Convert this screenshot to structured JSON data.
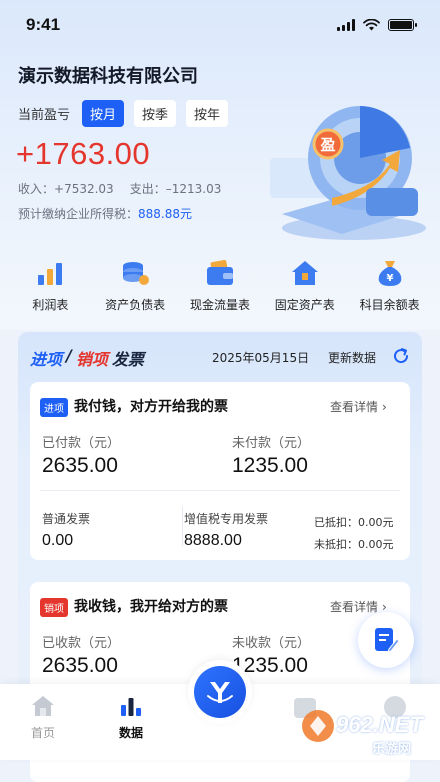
{
  "status_bar": {
    "time": "9:41"
  },
  "header": {
    "company": "演示数据科技有限公司",
    "period_label": "当前盈亏",
    "period_options": [
      "按月",
      "按季",
      "按年"
    ],
    "active_period": "按月",
    "profit": "+1763.00",
    "income_label": "收入：",
    "income_value": "+7532.03",
    "expense_label": "支出：",
    "expense_value": "–1213.03",
    "tax_label": "预计缴纳企业所得税：",
    "tax_value": "888.88元",
    "illustration_badge": "盈"
  },
  "quick_links": [
    {
      "label": "利润表",
      "icon": "bar-chart-icon"
    },
    {
      "label": "资产负债表",
      "icon": "coin-stack-icon"
    },
    {
      "label": "现金流量表",
      "icon": "wallet-icon"
    },
    {
      "label": "固定资产表",
      "icon": "house-icon"
    },
    {
      "label": "科目余额表",
      "icon": "money-bag-icon"
    }
  ],
  "invoice_panel": {
    "title_in": "进项",
    "title_sep": "/",
    "title_out": "销项",
    "title_suffix": "发票",
    "date": "2025年05月15日",
    "update_label": "更新数据",
    "in_card": {
      "tag": "进项",
      "title": "我付钱，对方开给我的票",
      "detail": "查看详情",
      "paid_label": "已付款（元）",
      "paid_value": "2635.00",
      "unpaid_label": "未付款（元）",
      "unpaid_value": "1235.00",
      "normal_label": "普通发票",
      "normal_value": "0.00",
      "vat_label": "增值税专用发票",
      "vat_value": "8888.00",
      "deducted": "已抵扣：0.00元",
      "not_deducted": "未抵扣：0.00元"
    },
    "out_card": {
      "tag": "销项",
      "title": "我收钱，我开给对方的票",
      "detail": "查看详情",
      "received_label": "已收款（元）",
      "received_value": "2635.00",
      "unreceived_label": "未收款（元）",
      "unreceived_value": "1235.00"
    }
  },
  "tabbar": {
    "tabs": [
      {
        "label": "首页",
        "icon": "home-icon"
      },
      {
        "label": "数据",
        "icon": "data-icon"
      }
    ],
    "active": "数据"
  },
  "watermark": {
    "text": "962.NET",
    "sub": "乐游网"
  },
  "colors": {
    "accent": "#1e5ff5",
    "profit": "#e5362d",
    "background": "#eef3fb"
  }
}
